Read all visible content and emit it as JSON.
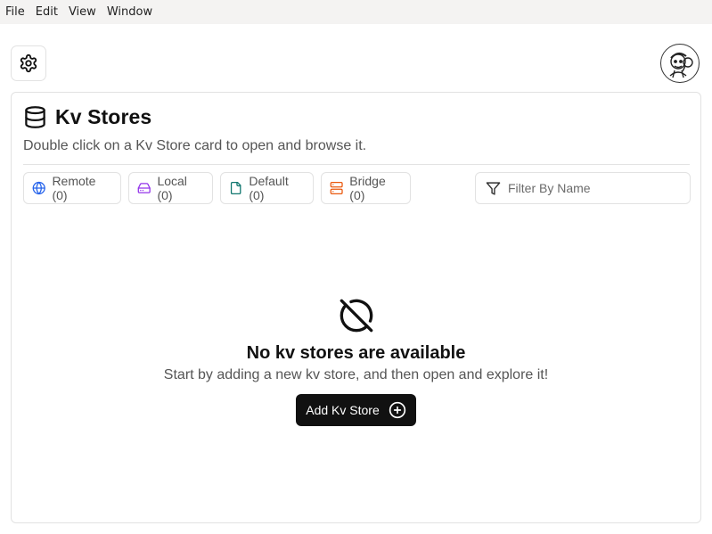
{
  "menubar": {
    "items": [
      "File",
      "Edit",
      "View",
      "Window"
    ]
  },
  "toolbar": {
    "settings_icon": "gear-icon",
    "avatar_icon": "user-avatar"
  },
  "page": {
    "title": "Kv Stores",
    "title_icon": "database-icon",
    "subtitle": "Double click on a Kv Store card to open and browse it."
  },
  "filters": {
    "remote": {
      "label": "Remote (0)",
      "icon": "globe-icon",
      "color": "#2563eb"
    },
    "local": {
      "label": "Local (0)",
      "icon": "hard-drive-icon",
      "color": "#9333ea"
    },
    "default": {
      "label": "Default (0)",
      "icon": "file-icon",
      "color": "#0f766e"
    },
    "bridge": {
      "label": "Bridge (0)",
      "icon": "server-icon",
      "color": "#ea580c"
    }
  },
  "search": {
    "placeholder": "Filter By Name",
    "value": ""
  },
  "empty_state": {
    "icon": "circle-off-icon",
    "title": "No kv stores are available",
    "description": "Start by adding a new kv store, and then open and explore it!",
    "button_label": "Add Kv Store"
  }
}
